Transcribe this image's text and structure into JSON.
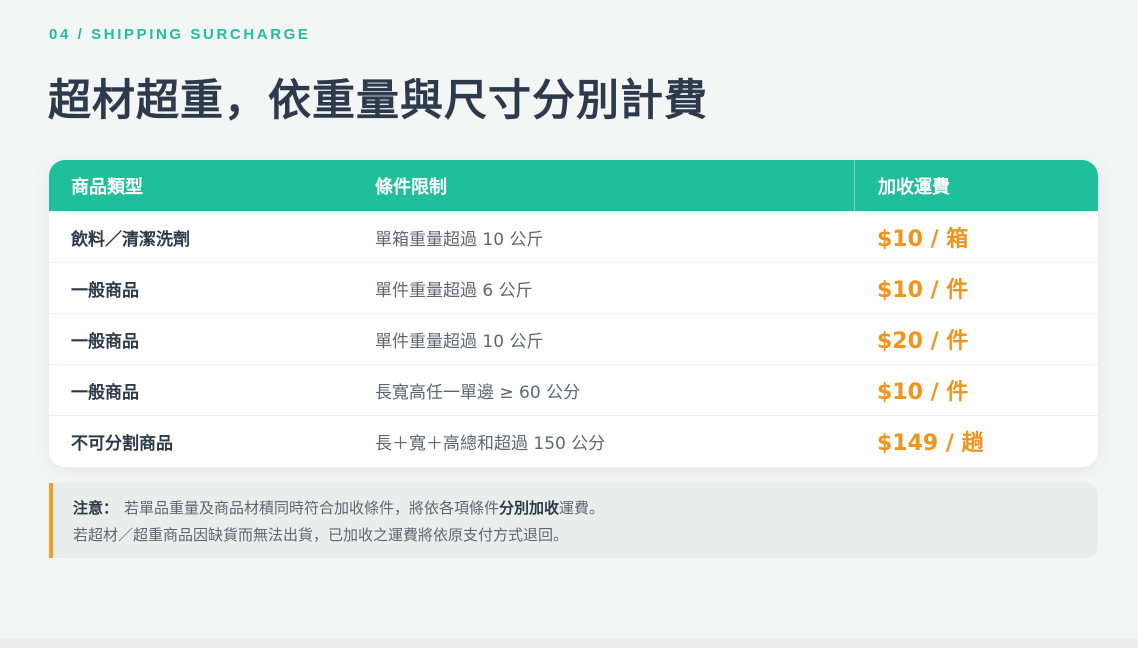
{
  "eyebrow": "04 / SHIPPING SURCHARGE",
  "headline": "超材超重，依重量與尺寸分別計費",
  "table": {
    "headers": [
      "商品類型",
      "條件限制",
      "加收運費"
    ],
    "rows": [
      {
        "type": "飲料／清潔洗劑",
        "condition": "單箱重量超過 10 公斤",
        "fee": "$10 / 箱"
      },
      {
        "type": "一般商品",
        "condition": "單件重量超過 6 公斤",
        "fee": "$10 / 件"
      },
      {
        "type": "一般商品",
        "condition": "單件重量超過 10 公斤",
        "fee": "$20 / 件"
      },
      {
        "type": "一般商品",
        "condition": "長寬高任一單邊 ≥ 60 公分",
        "fee": "$10 / 件"
      },
      {
        "type": "不可分割商品",
        "condition": "長＋寬＋高總和超過 150 公分",
        "fee": "$149 / 趟"
      }
    ]
  },
  "note": {
    "label": "注意：",
    "line1_before": "若單品重量及商品材積同時符合加收條件，將依各項條件",
    "line1_bold": "分別加收",
    "line1_after": "運費。",
    "line2": "若超材／超重商品因缺貨而無法出貨，已加收之運費將依原支付方式退回。"
  },
  "colors": {
    "accent": "#1fbf9b",
    "fee": "#f2931b",
    "note_bar": "#f2a11f",
    "heading": "#2c3a4b"
  }
}
